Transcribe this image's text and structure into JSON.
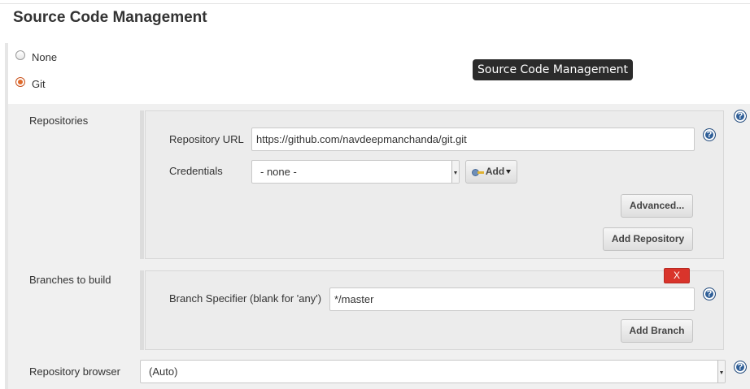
{
  "section": {
    "title": "Source Code Management"
  },
  "scm_options": [
    {
      "label": "None",
      "checked": false
    },
    {
      "label": "Git",
      "checked": true
    }
  ],
  "tooltip": {
    "text": "Source Code Management"
  },
  "repositories": {
    "label": "Repositories",
    "repo_url_label": "Repository URL",
    "repo_url_value": "https://github.com/navdeepmanchanda/git.git",
    "credentials_label": "Credentials",
    "credentials_selected": "- none -",
    "add_label": "Add",
    "advanced_label": "Advanced...",
    "add_repository_label": "Add Repository"
  },
  "branches": {
    "label": "Branches to build",
    "delete_label": "X",
    "specifier_label": "Branch Specifier (blank for 'any')",
    "specifier_value": "*/master",
    "add_branch_label": "Add Branch"
  },
  "repo_browser": {
    "label": "Repository browser",
    "selected": "(Auto)"
  },
  "help": {
    "glyph": "?"
  },
  "colors": {
    "delete_button": "#d9342b",
    "help_icon": "#2f5f98",
    "radio_selected": "#e06a2b",
    "tooltip_bg": "#2b2b2b"
  },
  "icons": [
    "help-icon",
    "key-icon",
    "dropdown-arrow-icon"
  ]
}
